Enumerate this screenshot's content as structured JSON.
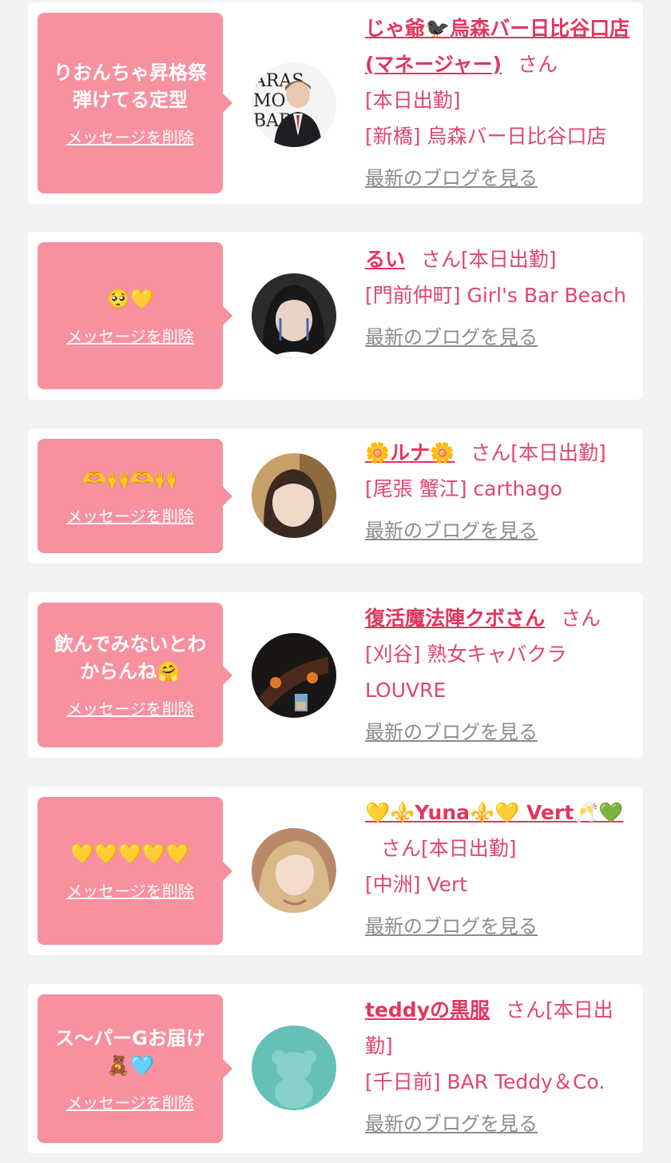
{
  "items": [
    {
      "message": "りおんちゃ昇格祭\n弾けてる定型",
      "delete_label": "メッセージを削除",
      "name": "じゃ爺🐦‍⬛烏森バー日比谷口店(マネージャー)",
      "san": "さん",
      "status": "[本日出勤]",
      "shop": "[新橋] 烏森バー日比谷口店",
      "blog_label": "最新のブログを見る",
      "avatar_text": "KARASU\nMORI\nBAR"
    },
    {
      "message": "🥺💛",
      "delete_label": "メッセージを削除",
      "name": "るい",
      "san": "さん",
      "status": "[本日出勤]",
      "shop": "[門前仲町] Girl's Bar Beach",
      "blog_label": "最新のブログを見る"
    },
    {
      "message": "🫶🙌🫶🙌",
      "delete_label": "メッセージを削除",
      "name": "🌼ルナ🌼",
      "san": "さん",
      "status": "[本日出勤]",
      "shop": "[尾張 蟹江] carthago",
      "blog_label": "最新のブログを見る"
    },
    {
      "message": "飲んでみないとわ\nからんね🤗",
      "delete_label": "メッセージを削除",
      "name": "復活魔法陣クボさん",
      "san": "さん",
      "status": "",
      "shop": "[刈谷] 熟女キャバクラ LOUVRE",
      "blog_label": "最新のブログを見る"
    },
    {
      "message": "💛💛💛💛💛",
      "delete_label": "メッセージを削除",
      "name": "💛⚜️Yuna⚜️💛 Vert🥂💚",
      "san": "さん",
      "status": "[本日出勤]",
      "shop": "[中洲] Vert",
      "blog_label": "最新のブログを見る"
    },
    {
      "message": "ス〜パーGお届け\n🧸🩵",
      "delete_label": "メッセージを削除",
      "name": "teddyの黒服",
      "san": "さん",
      "status": "[本日出勤]",
      "shop": "[千日前] BAR Teddy＆Co.",
      "blog_label": "最新のブログを見る"
    }
  ],
  "colors": {
    "background": "#f2f2f2",
    "card": "#ffffff",
    "bubble": "#f7909f",
    "name": "#e2365f",
    "text": "#e0466c",
    "blog_link": "#8c8c8c",
    "teddy_avatar": "#66c0b8"
  }
}
